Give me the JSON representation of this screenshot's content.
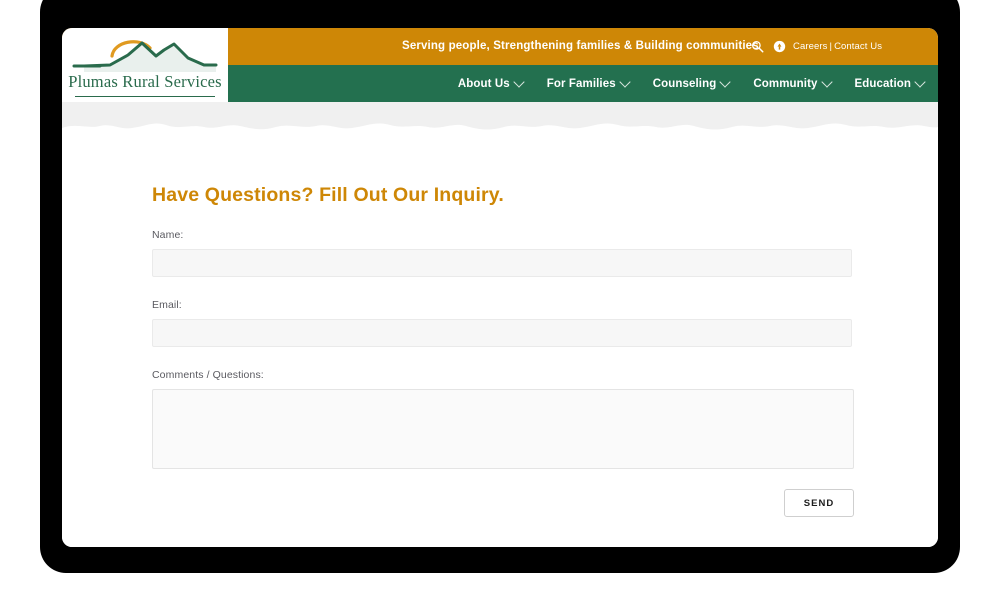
{
  "site": {
    "logo": {
      "wordmark": "Plumas Rural Services",
      "icon_name": "mountain-sunrise-logo"
    },
    "topbar": {
      "tagline": "Serving people, Strengthening families & Building communities",
      "search_icon": "search-icon",
      "info_icon": "info-circle-icon",
      "links": [
        {
          "label": "Careers"
        },
        {
          "label": "Contact Us"
        }
      ],
      "link_separator": "|",
      "background_color": "#CE8706",
      "text_color": "#FFFFFF"
    },
    "nav": {
      "background_color": "#23704F",
      "items": [
        {
          "label": "About Us",
          "has_dropdown": true
        },
        {
          "label": "For Families",
          "has_dropdown": true
        },
        {
          "label": "Counseling",
          "has_dropdown": true
        },
        {
          "label": "Community",
          "has_dropdown": true
        },
        {
          "label": "Education",
          "has_dropdown": true
        }
      ]
    }
  },
  "form": {
    "title": "Have Questions? Fill Out Our Inquiry.",
    "title_color": "#CE8706",
    "fields": [
      {
        "label": "Name:",
        "value": "",
        "placeholder": ""
      },
      {
        "label": "Email:",
        "value": "",
        "placeholder": ""
      }
    ],
    "comments": {
      "label": "Comments / Questions:",
      "value": "",
      "placeholder": ""
    },
    "submit_label": "SEND"
  }
}
